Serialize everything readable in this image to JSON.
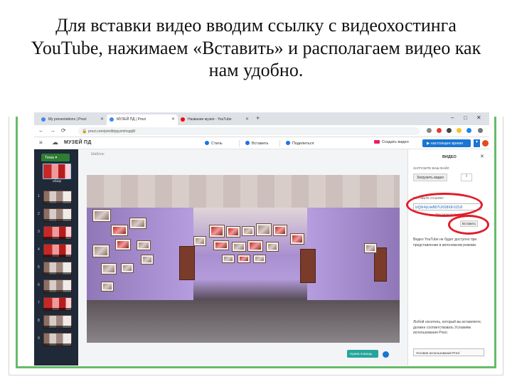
{
  "slide": {
    "title": "Для вставки видео вводим ссылку с видеохостинга YouTube, нажимаем «Вставить» и располагаем видео как нам удобно."
  },
  "browser": {
    "tabs": [
      {
        "label": "My presentations | Prezi",
        "favicon_color": "#4285f4"
      },
      {
        "label": "МУЗЕЙ ПД | Prezi",
        "favicon_color": "#4285f4"
      },
      {
        "label": "Название музея - YouTube",
        "favicon_color": "#ff0000"
      }
    ],
    "new_tab_label": "+",
    "window_controls": [
      "–",
      "□",
      "✕"
    ],
    "url": "prezi.com/p/edit/ppyxmhxgq8/",
    "nav": {
      "back": "←",
      "forward": "→",
      "reload": "⟳"
    },
    "extension_colors": [
      "#888888",
      "#e53935",
      "#444444",
      "#fbc02d",
      "#1e88e5",
      "#777777"
    ]
  },
  "toolbar": {
    "menu_icon": "≡",
    "cloud_icon": "☁",
    "doc_name": "МУЗЕЙ ПД",
    "style_label": "Стиль",
    "insert_label": "Вставить",
    "share_label": "Поделиться",
    "create_video_label": "Создать видео",
    "present_label": "▶ настоящее время",
    "more_label": "▾"
  },
  "sidebar": {
    "theme_button": "Тема ▾",
    "overview_label": "обзор",
    "items": [
      "1",
      "2",
      "3",
      "4",
      "5",
      "6",
      "7",
      "8",
      "9"
    ]
  },
  "canvas": {
    "tab_label": "Шаблон",
    "help_button": "Нужна помощь"
  },
  "right_panel": {
    "title": "ВИДЕО",
    "close": "✕",
    "upload_label": "ЗАГРУЗИТЕ ВАШ ФАЙЛ",
    "upload_button": "Загрузить видео",
    "info_button": "i",
    "link_label": "ВСТАВЬТЕ ССЫЛКУ",
    "url_value": "lzQ0r4yUwB07UXS8X8-5ZU0",
    "link_caption": "Лин видеоролика",
    "insert_button": "Вставить",
    "note": "Видео YouTube не будет доступно при представлении в автономном режиме.",
    "note2": "Любой носитель, который вы вставляете, должен соответствовать Условиям использования Prezi.",
    "terms_button": "Условия использования Prezi"
  },
  "colors": {
    "frame_green": "#66bb6a",
    "highlight_red": "#e11d2a",
    "present_blue": "#1976d2",
    "sidebar_bg": "#1f2937"
  }
}
